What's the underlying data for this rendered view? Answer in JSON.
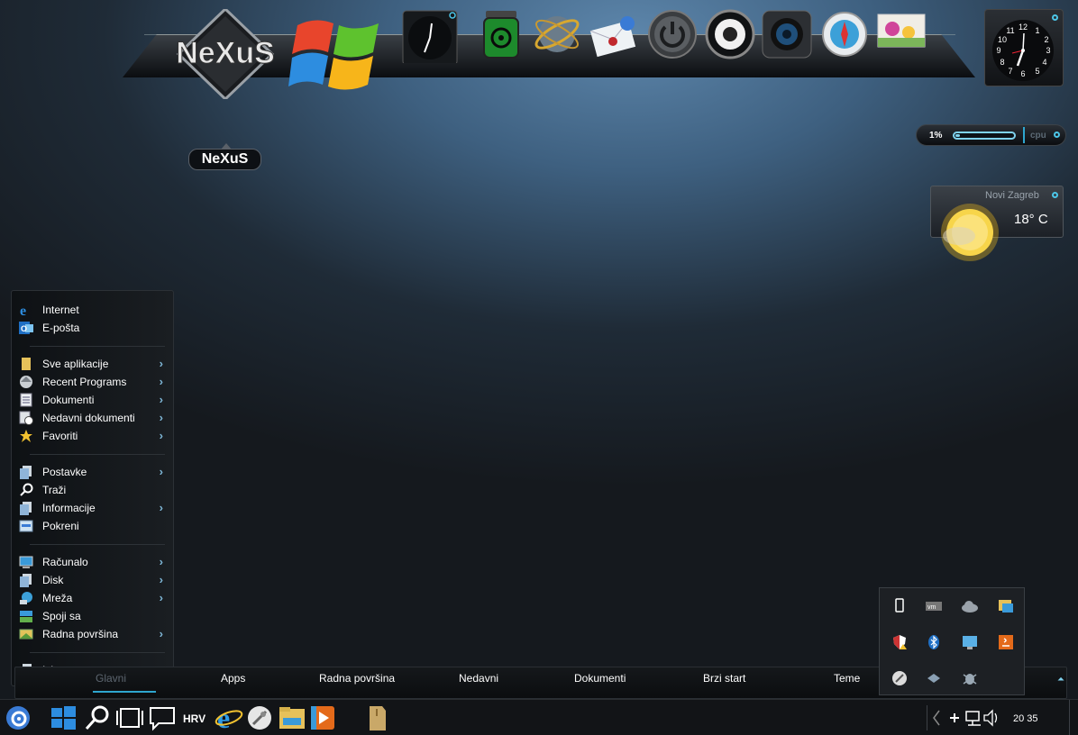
{
  "dock": {
    "logo_text": "NeXuS",
    "tooltip": "NeXuS",
    "icons": [
      "clock-icon",
      "biohazard-jar-icon",
      "globe-icon",
      "mail-icon",
      "power-icon",
      "speaker-icon",
      "camera-icon",
      "compass-icon",
      "photo-icon"
    ]
  },
  "clock_widget": {
    "numbers": [
      "12",
      "1",
      "2",
      "3",
      "4",
      "5",
      "6",
      "7",
      "8",
      "9",
      "10",
      "11"
    ]
  },
  "cpu_widget": {
    "percent_text": "1%",
    "percent_value": 1,
    "label": "cpu"
  },
  "weather": {
    "city": "Novi Zagreb",
    "temperature": "18° C"
  },
  "start_menu": {
    "items": [
      {
        "label": "Internet",
        "icon": "ie-icon",
        "arrow": false
      },
      {
        "label": "E-pošta",
        "icon": "outlook-icon",
        "arrow": false
      },
      {
        "label": "Sve aplikacije",
        "icon": "folder-icon",
        "arrow": true
      },
      {
        "label": "Recent Programs",
        "icon": "recent-programs-icon",
        "arrow": true
      },
      {
        "label": "Dokumenti",
        "icon": "documents-icon",
        "arrow": true
      },
      {
        "label": "Nedavni dokumenti",
        "icon": "recent-documents-icon",
        "arrow": true
      },
      {
        "label": "Favoriti",
        "icon": "star-icon",
        "arrow": true
      },
      {
        "label": "Postavke",
        "icon": "settings-icon",
        "arrow": true
      },
      {
        "label": "Traži",
        "icon": "search-icon",
        "arrow": false
      },
      {
        "label": "Informacije",
        "icon": "info-icon",
        "arrow": true
      },
      {
        "label": "Pokreni",
        "icon": "run-icon",
        "arrow": false
      },
      {
        "label": "Računalo",
        "icon": "computer-icon",
        "arrow": true
      },
      {
        "label": "Disk",
        "icon": "disk-icon",
        "arrow": true
      },
      {
        "label": "Mreža",
        "icon": "network-icon",
        "arrow": true
      },
      {
        "label": "Spoji sa",
        "icon": "connect-icon",
        "arrow": false
      },
      {
        "label": "Radna površina",
        "icon": "desktop-icon",
        "arrow": true
      },
      {
        "label": "Izlaz",
        "icon": "exit-icon",
        "arrow": true
      }
    ]
  },
  "tabs": [
    "Glavni",
    "Apps",
    "Radna površina",
    "Nedavni",
    "Dokumenti",
    "Brzi start",
    "Teme"
  ],
  "tray_popup": {
    "icons": [
      "usb-icon",
      "vmware-icon",
      "onedrive-icon",
      "network-folder-icon",
      "security-shield-icon",
      "bluetooth-icon",
      "display-icon",
      "java-icon",
      "rocket-icon",
      "dropbox-icon",
      "bug-icon"
    ]
  },
  "taskbar": {
    "language": "HRV",
    "time": "20 35",
    "icons": [
      "nexus-icon",
      "windows-icon",
      "search-icon",
      "task-view-icon",
      "chat-icon",
      "ie-icon",
      "rocket-icon",
      "file-explorer-icon",
      "media-player-icon",
      "archive-icon"
    ],
    "tray": [
      "plus-icon",
      "network-icon",
      "volume-icon"
    ]
  },
  "colors": {
    "accent": "#2ea6cf",
    "menu_bg": "#0e1114",
    "taskbar_bg": "#121417"
  }
}
